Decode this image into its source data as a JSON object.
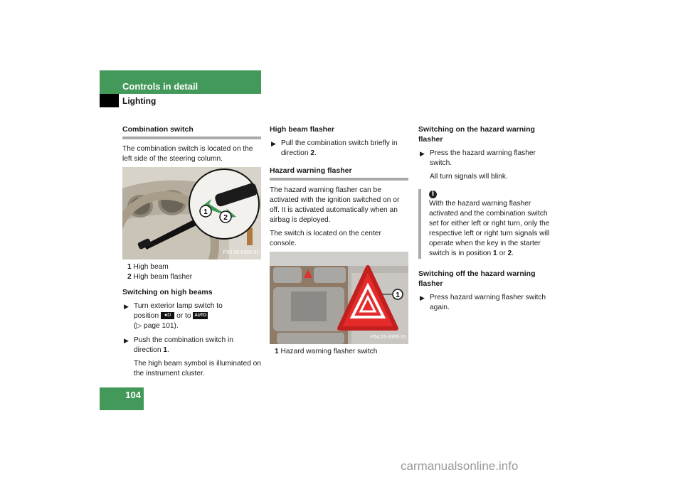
{
  "header": {
    "section": "Controls in detail",
    "subsection": "Lighting"
  },
  "page_number": "104",
  "col1": {
    "heading": "Combination switch",
    "intro": "The combination switch is located on the left side of the steering column.",
    "figure": {
      "code": "P54.30-6360-31",
      "callouts": [
        "1",
        "2"
      ]
    },
    "legend": [
      {
        "num": "1",
        "text": "High beam"
      },
      {
        "num": "2",
        "text": "High beam flasher"
      }
    ],
    "sub_heading": "Switching on high beams",
    "step1": {
      "line1": "Turn exterior lamp switch to",
      "line2_pre": "position",
      "symbol1": "headlamp-symbol",
      "line2_mid": "or to",
      "symbol2": "AUTO",
      "line3": "(▷ page 101)."
    },
    "step2": {
      "pre": "Push the combination switch in direction",
      "num": "1",
      "post": "."
    },
    "step2_note": "The high beam symbol is illuminated on the instrument cluster."
  },
  "col2": {
    "heading1": "High beam flasher",
    "step1": {
      "pre": "Pull the combination switch briefly in direction",
      "num": "2",
      "post": "."
    },
    "heading2": "Hazard warning flasher",
    "para1": "The hazard warning flasher can be activated with the ignition switched on or off. It is activated automatically when an airbag is deployed.",
    "para2": "The switch is located on the center console.",
    "figure": {
      "code": "P54.25-3300-31",
      "callouts": [
        "1"
      ]
    },
    "legend": [
      {
        "num": "1",
        "text": "Hazard warning flasher switch"
      }
    ]
  },
  "col3": {
    "heading1": "Switching on the hazard warning flasher",
    "step1": "Press the hazard warning flasher switch.",
    "step1_note": "All turn signals will blink.",
    "info": {
      "icon": "info-icon",
      "text_pre": "With the hazard warning flasher activated and the combination switch set for either left or right turn, only the respective left or right turn signals will operate when the key in the starter switch is in position",
      "num1": "1",
      "mid": "or",
      "num2": "2",
      "post": "."
    },
    "heading2": "Switching off the hazard warning flasher",
    "step2": "Press hazard warning flasher switch again."
  },
  "watermark": "carmanualsonline.info",
  "colors": {
    "brand_green": "#43995a",
    "rule_gray": "#aaaaaa",
    "hazard_red": "#e52a2a"
  }
}
